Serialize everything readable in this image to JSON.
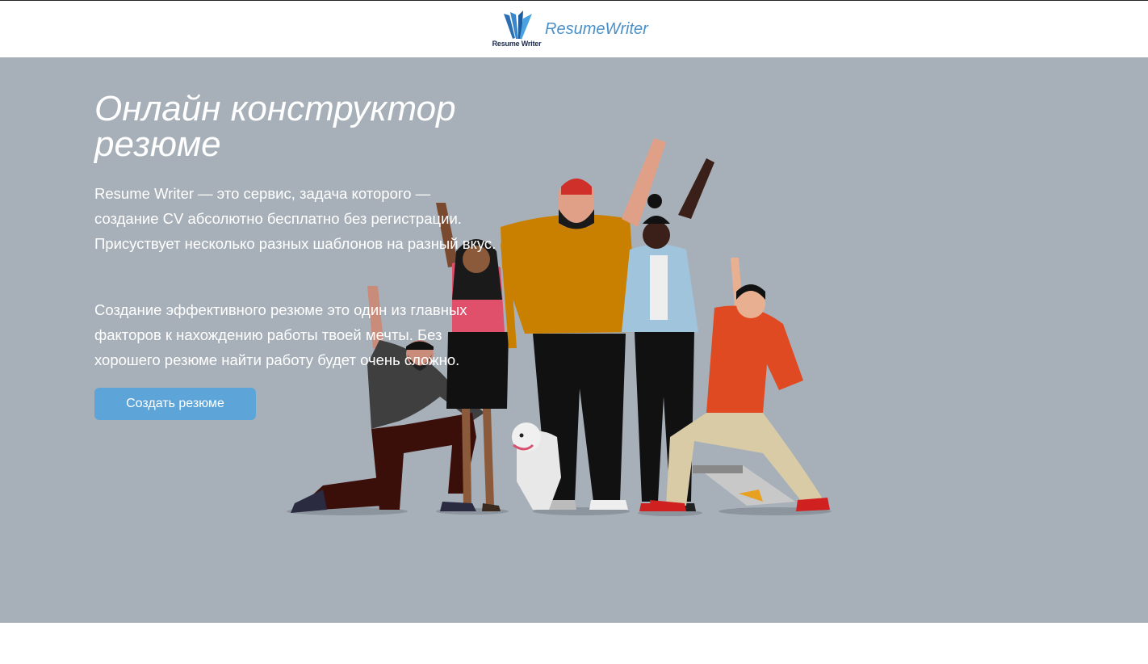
{
  "header": {
    "logo_text": "Resume Writer",
    "brand_name": "ResumeWriter"
  },
  "hero": {
    "title": "Онлайн конструктор резюме",
    "paragraph_1": "Resume Writer — это сервис, задача которого — создание CV абсолютно бесплатно без регистрации. Присуствует несколько разных шаблонов на разный вкус.",
    "paragraph_2": "Создание эффективного резюме это один из главных факторов к нахождению работы твоей мечты. Без хорошего резюме найти работу будет очень сложно.",
    "cta_label": "Создать резюме"
  },
  "colors": {
    "hero_background": "#a7b0b9",
    "accent": "#5da5d9",
    "brand_text": "#4a90c8"
  },
  "icons": [
    "resume-writer-logo-icon",
    "people-group-illustration"
  ]
}
